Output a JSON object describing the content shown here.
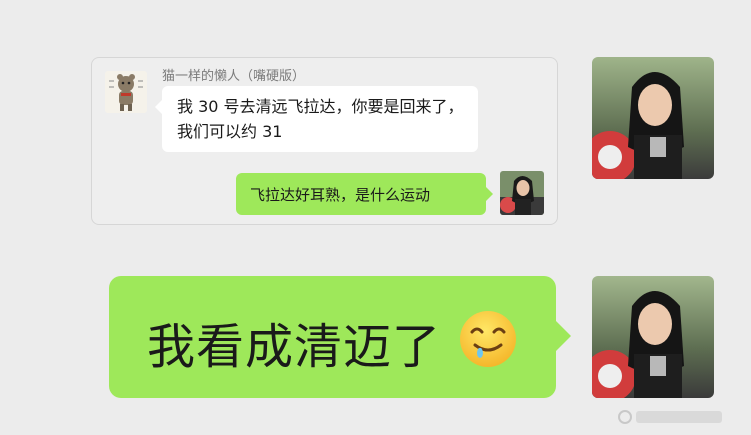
{
  "quoted_message": {
    "sender_name": "猫一样的懒人（嘴硬版）",
    "incoming_text": "我 30 号去清远飞拉达，你要是回来了，我们可以约 31",
    "outgoing_text": "飞拉达好耳熟，是什么运动"
  },
  "main_message": {
    "text": "我看成清迈了",
    "emoji": "drooling-face-emoji"
  },
  "colors": {
    "background": "#ececec",
    "outgoing_bubble": "#9ee85a",
    "incoming_bubble": "#ffffff"
  }
}
